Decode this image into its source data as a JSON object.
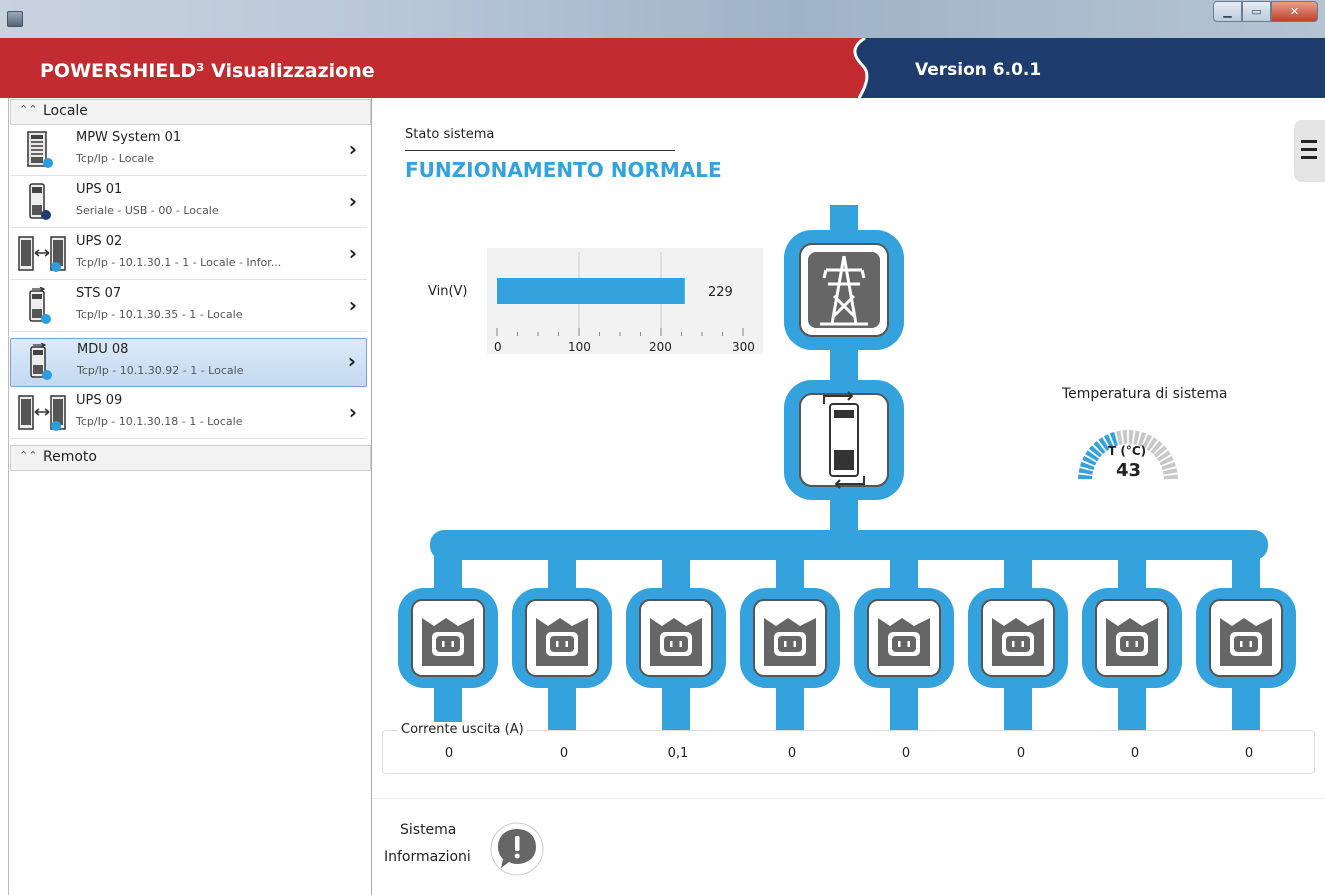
{
  "header": {
    "app_title": "POWERSHIELD³ Visualizzazione",
    "version": "Version 6.0.1",
    "brand_red": "#c22b2f",
    "brand_blue": "#1e3c6e"
  },
  "sidebar": {
    "groups": [
      {
        "label": "Locale",
        "expanded": true
      },
      {
        "label": "Remoto",
        "expanded": true
      }
    ],
    "devices": [
      {
        "name": "MPW System 01",
        "sub": "Tcp/Ip - Locale",
        "icon": "mpw-cabinet-icon"
      },
      {
        "name": "UPS 01",
        "sub": "Seriale - USB - 00 - Locale",
        "icon": "ups-tower-icon"
      },
      {
        "name": "UPS 02",
        "sub": "Tcp/Ip - 10.1.30.1 - 1 - Locale - Infor...",
        "icon": "ups-parallel-icon"
      },
      {
        "name": "STS 07",
        "sub": "Tcp/Ip - 10.1.30.35 - 1 - Locale",
        "icon": "sts-icon"
      },
      {
        "name": "MDU 08",
        "sub": "Tcp/Ip - 10.1.30.92 - 1 - Locale",
        "icon": "mdu-icon",
        "selected": true
      },
      {
        "name": "UPS 09",
        "sub": "Tcp/Ip - 10.1.30.18 - 1 - Locale",
        "icon": "ups-parallel-icon"
      }
    ]
  },
  "main": {
    "stato_label": "Stato sistema",
    "stato_value": "FUNZIONAMENTO NORMALE",
    "accent": "#33a2dd",
    "vin": {
      "label": "Vin(V)",
      "value": 229,
      "value_text": "229",
      "axis_min": 0,
      "axis_max": 300,
      "ticks": [
        "0",
        "100",
        "200",
        "300"
      ]
    },
    "temperature": {
      "label": "Temperatura di sistema",
      "unit": "T (°C)",
      "value": 43,
      "value_text": "43",
      "gauge_min": 0,
      "gauge_max": 100
    },
    "outputs": {
      "label": "Corrente uscita (A)",
      "values": [
        "0",
        "0",
        "0,1",
        "0",
        "0",
        "0",
        "0",
        "0"
      ]
    },
    "info": {
      "line1": "Sistema",
      "line2": "Informazioni"
    }
  }
}
